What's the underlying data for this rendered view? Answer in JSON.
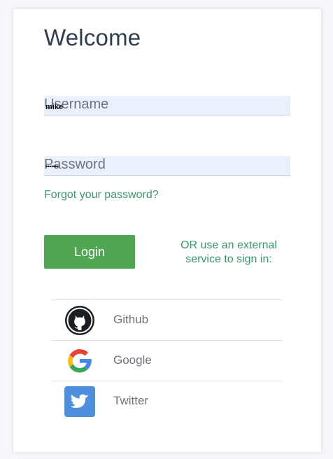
{
  "page": {
    "title": "Welcome"
  },
  "form": {
    "username": {
      "placeholder": "Username",
      "value": "mike"
    },
    "password": {
      "placeholder": "Password",
      "value": "•••••••"
    },
    "forgot_link": "Forgot your password?",
    "login_label": "Login",
    "external_text": "OR use an external service to sign in:"
  },
  "providers": [
    {
      "label": "Github",
      "icon": "github-icon"
    },
    {
      "label": "Google",
      "icon": "google-icon"
    },
    {
      "label": "Twitter",
      "icon": "twitter-icon"
    }
  ],
  "colors": {
    "accent_green": "#51a651",
    "link_green": "#3a9a6a",
    "title_dark": "#2f3e4e",
    "field_fill": "#e9f0fe"
  }
}
